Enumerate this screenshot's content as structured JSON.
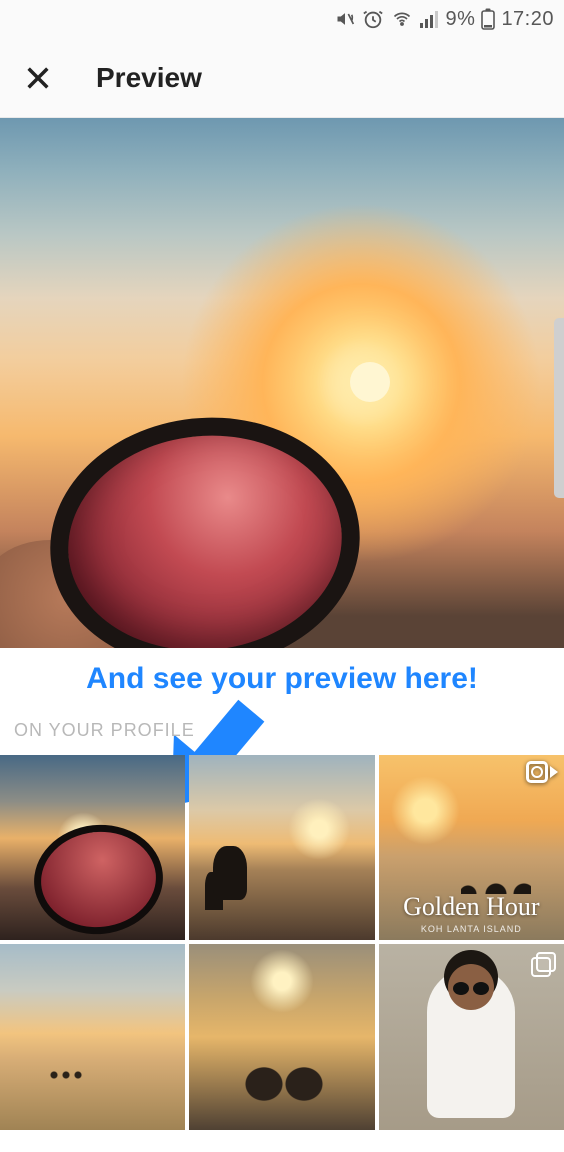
{
  "status_bar": {
    "battery_percent": "9%",
    "time": "17:20"
  },
  "header": {
    "title": "Preview"
  },
  "annotation": {
    "text": "And see your preview here!"
  },
  "section": {
    "on_profile_label": "ON YOUR PROFILE"
  },
  "grid": {
    "items": [
      {
        "badge": null
      },
      {
        "badge": null
      },
      {
        "badge": "video",
        "caption": "Golden Hour",
        "subcaption": "Koh Lanta Island"
      },
      {
        "badge": null
      },
      {
        "badge": null
      },
      {
        "badge": "multi"
      }
    ]
  }
}
